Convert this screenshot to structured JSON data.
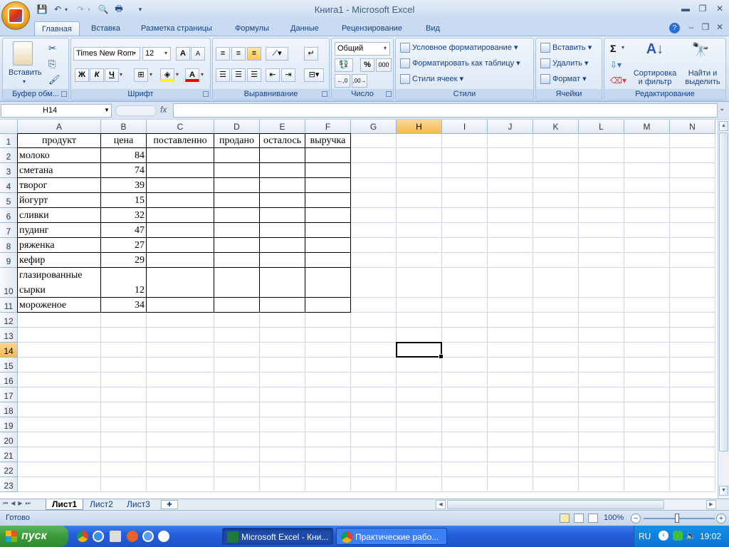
{
  "window": {
    "title": "Книга1 - Microsoft Excel"
  },
  "ribbon_tabs": [
    "Главная",
    "Вставка",
    "Разметка страницы",
    "Формулы",
    "Данные",
    "Рецензирование",
    "Вид"
  ],
  "ribbon": {
    "clipboard": {
      "label": "Буфер обм...",
      "paste": "Вставить"
    },
    "font": {
      "label": "Шрифт",
      "font_name": "Times New Rom",
      "font_size": "12",
      "bold": "Ж",
      "italic": "К",
      "underline": "Ч",
      "grow": "A",
      "shrink": "A",
      "font_color": "A"
    },
    "alignment": {
      "label": "Выравнивание"
    },
    "number": {
      "label": "Число",
      "format": "Общий",
      "percent": "%",
      "thousands": "000"
    },
    "styles": {
      "label": "Стили",
      "conditional": "Условное форматирование",
      "as_table": "Форматировать как таблицу",
      "cell_styles": "Стили ячеек"
    },
    "cells": {
      "label": "Ячейки",
      "insert": "Вставить",
      "delete": "Удалить",
      "format": "Формат"
    },
    "editing": {
      "label": "Редактирование",
      "sigma": "Σ",
      "sort_line1": "Сортировка",
      "sort_line2": "и фильтр",
      "find_line1": "Найти и",
      "find_line2": "выделить"
    }
  },
  "formula_bar": {
    "name_box": "H14",
    "fx": "fx",
    "value": ""
  },
  "columns": [
    "A",
    "B",
    "C",
    "D",
    "E",
    "F",
    "G",
    "H",
    "I",
    "J",
    "K",
    "L",
    "M",
    "N"
  ],
  "rows": [
    "1",
    "2",
    "3",
    "4",
    "5",
    "6",
    "7",
    "8",
    "9",
    "10",
    "11",
    "12",
    "13",
    "14",
    "15",
    "16",
    "17",
    "18",
    "19",
    "20",
    "21",
    "22",
    "23"
  ],
  "selected_cell": {
    "column": "H",
    "row": "14"
  },
  "table": {
    "headers": [
      "продукт",
      "цена",
      "поставленно",
      "продано",
      "осталось",
      "выручка"
    ],
    "rows": [
      {
        "product": "молоко",
        "price": "84"
      },
      {
        "product": "сметана",
        "price": "74"
      },
      {
        "product": "творог",
        "price": "39"
      },
      {
        "product": "йогурт",
        "price": "15"
      },
      {
        "product": "сливки",
        "price": "32"
      },
      {
        "product": "пудинг",
        "price": "47"
      },
      {
        "product": "ряженка",
        "price": "27"
      },
      {
        "product": "кефир",
        "price": "29"
      },
      {
        "product_line1": "глазированные",
        "product_line2": "сырки",
        "price": "12"
      },
      {
        "product": "мороженое",
        "price": "34"
      }
    ]
  },
  "sheets": [
    "Лист1",
    "Лист2",
    "Лист3"
  ],
  "status": {
    "ready": "Готово",
    "zoom": "100%"
  },
  "taskbar": {
    "start": "пуск",
    "tasks": [
      "Microsoft Excel - Кни...",
      "Практические рабо..."
    ],
    "lang": "RU",
    "clock": "19:02"
  }
}
